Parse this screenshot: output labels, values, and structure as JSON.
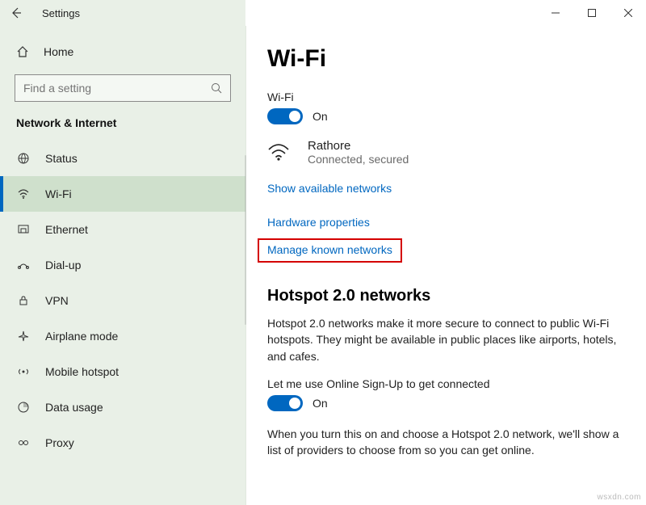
{
  "titlebar": {
    "title": "Settings"
  },
  "sidebar": {
    "home": "Home",
    "search_placeholder": "Find a setting",
    "category": "Network & Internet",
    "items": [
      {
        "label": "Status"
      },
      {
        "label": "Wi-Fi"
      },
      {
        "label": "Ethernet"
      },
      {
        "label": "Dial-up"
      },
      {
        "label": "VPN"
      },
      {
        "label": "Airplane mode"
      },
      {
        "label": "Mobile hotspot"
      },
      {
        "label": "Data usage"
      },
      {
        "label": "Proxy"
      }
    ]
  },
  "main": {
    "heading": "Wi-Fi",
    "wifi_label": "Wi-Fi",
    "wifi_toggle_state": "On",
    "network": {
      "name": "Rathore",
      "status": "Connected, secured"
    },
    "links": {
      "show_available": "Show available networks",
      "hardware_props": "Hardware properties",
      "manage_known": "Manage known networks"
    },
    "hotspot": {
      "heading": "Hotspot 2.0 networks",
      "desc": "Hotspot 2.0 networks make it more secure to connect to public Wi-Fi hotspots. They might be available in public places like airports, hotels, and cafes.",
      "toggle_label": "Let me use Online Sign-Up to get connected",
      "toggle_state": "On",
      "desc2": "When you turn this on and choose a Hotspot 2.0 network, we'll show a list of providers to choose from so you can get online."
    }
  },
  "watermark": "wsxdn.com"
}
